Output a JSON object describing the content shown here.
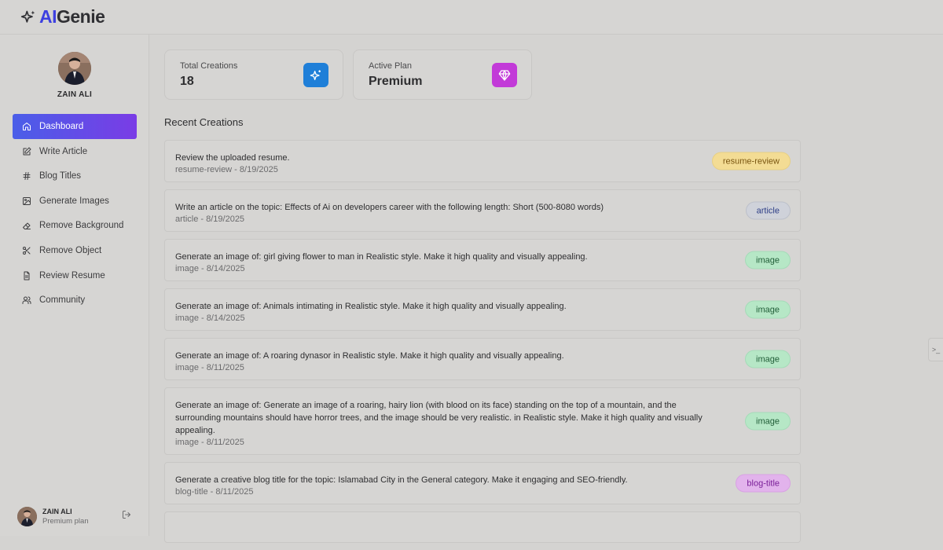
{
  "app": {
    "logo_prefix": "AI",
    "logo_suffix": "Genie"
  },
  "profile": {
    "name": "ZAIN ALI"
  },
  "nav": [
    {
      "label": "Dashboard",
      "icon": "home-icon",
      "active": true
    },
    {
      "label": "Write Article",
      "icon": "edit-icon",
      "active": false
    },
    {
      "label": "Blog Titles",
      "icon": "hash-icon",
      "active": false
    },
    {
      "label": "Generate Images",
      "icon": "image-icon",
      "active": false
    },
    {
      "label": "Remove Background",
      "icon": "eraser-icon",
      "active": false
    },
    {
      "label": "Remove Object",
      "icon": "scissors-icon",
      "active": false
    },
    {
      "label": "Review Resume",
      "icon": "file-text-icon",
      "active": false
    },
    {
      "label": "Community",
      "icon": "users-icon",
      "active": false
    }
  ],
  "footer": {
    "name": "ZAIN ALI",
    "plan": "Premium plan"
  },
  "stats": [
    {
      "label": "Total Creations",
      "value": "18",
      "icon": "sparkles-icon",
      "color": "#1f7fd8"
    },
    {
      "label": "Active Plan",
      "value": "Premium",
      "icon": "gem-icon",
      "color": "#c23ad8"
    }
  ],
  "recent": {
    "title": "Recent Creations",
    "items": [
      {
        "title": "Review the uploaded resume.",
        "meta": "resume-review - 8/19/2025",
        "badge": "resume-review",
        "kind": "resume"
      },
      {
        "title": "Write an article on the topic: Effects of Ai on developers career with the following length: Short (500-8080 words)",
        "meta": "article - 8/19/2025",
        "badge": "article",
        "kind": "article"
      },
      {
        "title": "Generate an image of: girl giving flower to man in Realistic style. Make it high quality and visually appealing.",
        "meta": "image - 8/14/2025",
        "badge": "image",
        "kind": "image"
      },
      {
        "title": "Generate an image of: Animals intimating in Realistic style. Make it high quality and visually appealing.",
        "meta": "image - 8/14/2025",
        "badge": "image",
        "kind": "image"
      },
      {
        "title": "Generate an image of: A roaring dynasor in Realistic style. Make it high quality and visually appealing.",
        "meta": "image - 8/11/2025",
        "badge": "image",
        "kind": "image"
      },
      {
        "title": "Generate an image of: Generate an image of a roaring, hairy lion (with blood on its face) standing on the top of a mountain, and the surrounding mountains should have horror trees, and the image should be very realistic. in Realistic style. Make it high quality and visually appealing.",
        "meta": "image - 8/11/2025",
        "badge": "image",
        "kind": "image"
      },
      {
        "title": "Generate a creative blog title for the topic: Islamabad City in the General category. Make it engaging and SEO-friendly.",
        "meta": "blog-title - 8/11/2025",
        "badge": "blog-title",
        "kind": "blog"
      },
      {
        "title": "",
        "meta": "",
        "badge": "",
        "kind": "image"
      }
    ]
  },
  "edge_tab": {
    "label": ">_"
  }
}
